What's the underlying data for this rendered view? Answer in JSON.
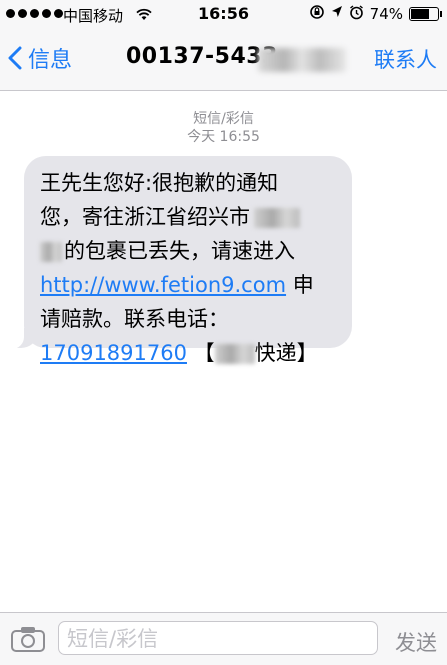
{
  "status_bar": {
    "carrier": "中国移动",
    "time": "16:56",
    "battery_text": "74%",
    "battery_level": 0.74,
    "signal_icon": "signal-dots-icon",
    "wifi_icon": "wifi-icon"
  },
  "nav": {
    "back_label": "信息",
    "title": "00137-5433",
    "contact_label": "联系人"
  },
  "messages": {
    "kind": "短信/彩信",
    "timestamp": "今天 16:55",
    "line1": "王先生您好:很抱歉的通知",
    "line2": "您，寄往浙江省绍兴市",
    "line3": "的包裹已丢失，请速进入",
    "link": "http://www.fetion9.com",
    "line4_suffix": " 申",
    "line5": "请赔款。联系电话：",
    "phone": "17091891760",
    "bracket_open": " 【",
    "courier_suffix": "快递】"
  },
  "input": {
    "placeholder": "短信/彩信",
    "send_label": "发送"
  },
  "accent_color": "#1e7cf5"
}
